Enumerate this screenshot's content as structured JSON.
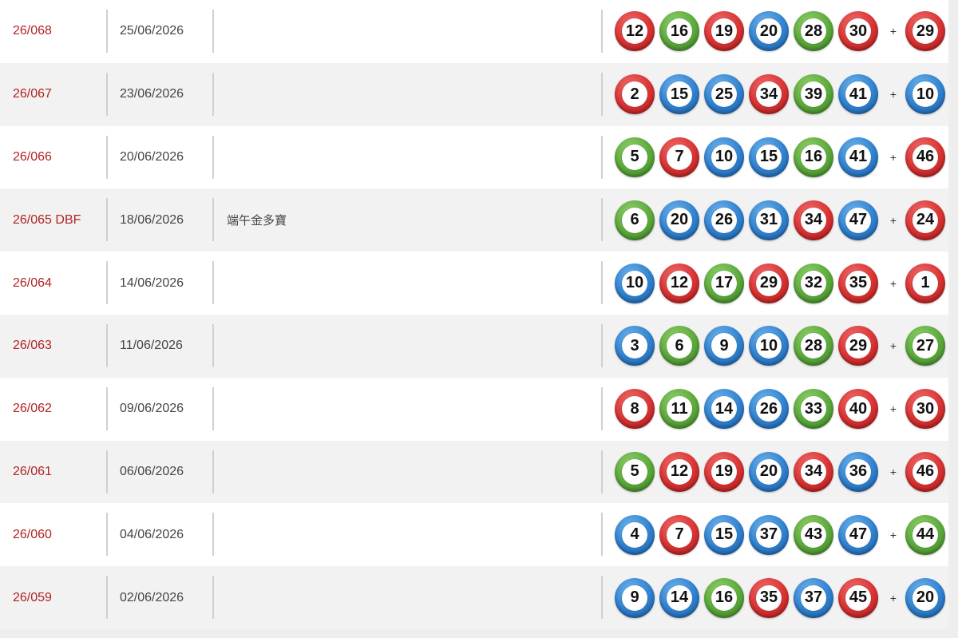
{
  "colors": {
    "red": "#d83232",
    "green": "#5aa83a",
    "blue": "#2f80cf",
    "draw_link": "#b22222"
  },
  "plus_sign": "+",
  "rows": [
    {
      "draw": "26/068",
      "date": "25/06/2026",
      "name": "",
      "balls": [
        {
          "n": "12",
          "c": "red"
        },
        {
          "n": "16",
          "c": "green"
        },
        {
          "n": "19",
          "c": "red"
        },
        {
          "n": "20",
          "c": "blue"
        },
        {
          "n": "28",
          "c": "green"
        },
        {
          "n": "30",
          "c": "red"
        }
      ],
      "extra": {
        "n": "29",
        "c": "red"
      }
    },
    {
      "draw": "26/067",
      "date": "23/06/2026",
      "name": "",
      "balls": [
        {
          "n": "2",
          "c": "red"
        },
        {
          "n": "15",
          "c": "blue"
        },
        {
          "n": "25",
          "c": "blue"
        },
        {
          "n": "34",
          "c": "red"
        },
        {
          "n": "39",
          "c": "green"
        },
        {
          "n": "41",
          "c": "blue"
        }
      ],
      "extra": {
        "n": "10",
        "c": "blue"
      }
    },
    {
      "draw": "26/066",
      "date": "20/06/2026",
      "name": "",
      "balls": [
        {
          "n": "5",
          "c": "green"
        },
        {
          "n": "7",
          "c": "red"
        },
        {
          "n": "10",
          "c": "blue"
        },
        {
          "n": "15",
          "c": "blue"
        },
        {
          "n": "16",
          "c": "green"
        },
        {
          "n": "41",
          "c": "blue"
        }
      ],
      "extra": {
        "n": "46",
        "c": "red"
      }
    },
    {
      "draw": "26/065 DBF",
      "date": "18/06/2026",
      "name": "端午金多寶",
      "balls": [
        {
          "n": "6",
          "c": "green"
        },
        {
          "n": "20",
          "c": "blue"
        },
        {
          "n": "26",
          "c": "blue"
        },
        {
          "n": "31",
          "c": "blue"
        },
        {
          "n": "34",
          "c": "red"
        },
        {
          "n": "47",
          "c": "blue"
        }
      ],
      "extra": {
        "n": "24",
        "c": "red"
      }
    },
    {
      "draw": "26/064",
      "date": "14/06/2026",
      "name": "",
      "balls": [
        {
          "n": "10",
          "c": "blue"
        },
        {
          "n": "12",
          "c": "red"
        },
        {
          "n": "17",
          "c": "green"
        },
        {
          "n": "29",
          "c": "red"
        },
        {
          "n": "32",
          "c": "green"
        },
        {
          "n": "35",
          "c": "red"
        }
      ],
      "extra": {
        "n": "1",
        "c": "red"
      }
    },
    {
      "draw": "26/063",
      "date": "11/06/2026",
      "name": "",
      "balls": [
        {
          "n": "3",
          "c": "blue"
        },
        {
          "n": "6",
          "c": "green"
        },
        {
          "n": "9",
          "c": "blue"
        },
        {
          "n": "10",
          "c": "blue"
        },
        {
          "n": "28",
          "c": "green"
        },
        {
          "n": "29",
          "c": "red"
        }
      ],
      "extra": {
        "n": "27",
        "c": "green"
      }
    },
    {
      "draw": "26/062",
      "date": "09/06/2026",
      "name": "",
      "balls": [
        {
          "n": "8",
          "c": "red"
        },
        {
          "n": "11",
          "c": "green"
        },
        {
          "n": "14",
          "c": "blue"
        },
        {
          "n": "26",
          "c": "blue"
        },
        {
          "n": "33",
          "c": "green"
        },
        {
          "n": "40",
          "c": "red"
        }
      ],
      "extra": {
        "n": "30",
        "c": "red"
      }
    },
    {
      "draw": "26/061",
      "date": "06/06/2026",
      "name": "",
      "balls": [
        {
          "n": "5",
          "c": "green"
        },
        {
          "n": "12",
          "c": "red"
        },
        {
          "n": "19",
          "c": "red"
        },
        {
          "n": "20",
          "c": "blue"
        },
        {
          "n": "34",
          "c": "red"
        },
        {
          "n": "36",
          "c": "blue"
        }
      ],
      "extra": {
        "n": "46",
        "c": "red"
      }
    },
    {
      "draw": "26/060",
      "date": "04/06/2026",
      "name": "",
      "balls": [
        {
          "n": "4",
          "c": "blue"
        },
        {
          "n": "7",
          "c": "red"
        },
        {
          "n": "15",
          "c": "blue"
        },
        {
          "n": "37",
          "c": "blue"
        },
        {
          "n": "43",
          "c": "green"
        },
        {
          "n": "47",
          "c": "blue"
        }
      ],
      "extra": {
        "n": "44",
        "c": "green"
      }
    },
    {
      "draw": "26/059",
      "date": "02/06/2026",
      "name": "",
      "balls": [
        {
          "n": "9",
          "c": "blue"
        },
        {
          "n": "14",
          "c": "blue"
        },
        {
          "n": "16",
          "c": "green"
        },
        {
          "n": "35",
          "c": "red"
        },
        {
          "n": "37",
          "c": "blue"
        },
        {
          "n": "45",
          "c": "red"
        }
      ],
      "extra": {
        "n": "20",
        "c": "blue"
      }
    }
  ]
}
